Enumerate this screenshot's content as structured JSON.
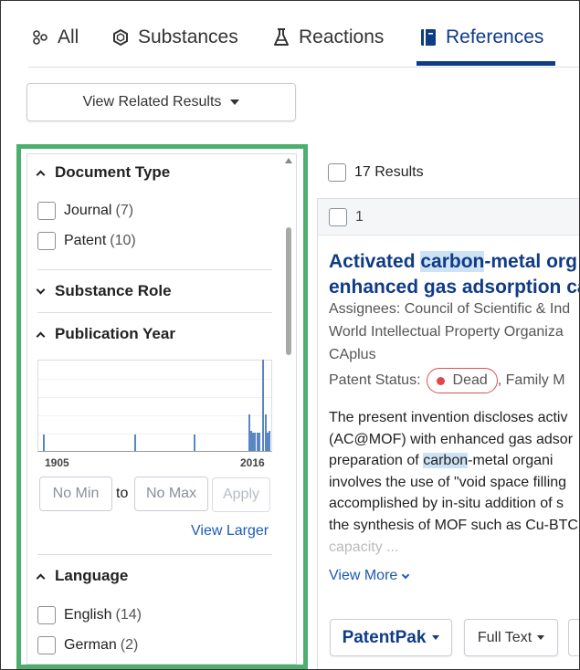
{
  "tabs": [
    {
      "label": "All",
      "icon": "all-icon"
    },
    {
      "label": "Substances",
      "icon": "substance-hexagon-icon"
    },
    {
      "label": "Reactions",
      "icon": "flask-icon"
    },
    {
      "label": "References",
      "icon": "book-icon",
      "active": true
    }
  ],
  "view_related": {
    "label": "View Related Results"
  },
  "filters": {
    "document_type": {
      "title": "Document Type",
      "options": [
        {
          "label": "Journal",
          "count": "(7)"
        },
        {
          "label": "Patent",
          "count": "(10)"
        }
      ]
    },
    "substance_role": {
      "title": "Substance Role"
    },
    "publication_year": {
      "title": "Publication Year",
      "min_label": "1905",
      "max_label": "2016",
      "min_placeholder": "No Min",
      "to_label": "to",
      "max_placeholder": "No Max",
      "apply_label": "Apply",
      "view_larger_label": "View Larger",
      "histogram": {
        "year_range": [
          1905,
          2016
        ],
        "bars": [
          {
            "year": 1905,
            "level": 0.18
          },
          {
            "year": 1950,
            "level": 0.18
          },
          {
            "year": 1979,
            "level": 0.18
          },
          {
            "year": 2006,
            "level": 0.4
          },
          {
            "year": 2007,
            "level": 0.22
          },
          {
            "year": 2008,
            "level": 0.2
          },
          {
            "year": 2009,
            "level": 0.2
          },
          {
            "year": 2010,
            "level": 0.2
          },
          {
            "year": 2011,
            "level": 0.2
          },
          {
            "year": 2013,
            "level": 1.0
          },
          {
            "year": 2014,
            "level": 0.4
          },
          {
            "year": 2015,
            "level": 0.2
          },
          {
            "year": 2016,
            "level": 0.22
          }
        ]
      }
    },
    "language": {
      "title": "Language",
      "options": [
        {
          "label": "English",
          "count": "(14)"
        },
        {
          "label": "German",
          "count": "(2)"
        }
      ]
    }
  },
  "results": {
    "count_label": "17 Results",
    "items": [
      {
        "index": "1",
        "title_line1_pre": "Activated ",
        "title_line1_hl": "carbon",
        "title_line1_post": "-metal org",
        "title_line2": "enhanced gas adsorption ca",
        "assignees_label": "Assignees:",
        "assignees_value": "Council of Scientific & Ind",
        "office": "World Intellectual Property Organiza",
        "database": "CAplus",
        "patent_status_label": "Patent Status:",
        "patent_status_value": "Dead",
        "family_label": ", Family M",
        "abstract_lines": [
          "The present invention discloses activ",
          "(AC@MOF) with enhanced gas adsor",
          "involves the use of \"void space filling",
          "accomplished by in-situ addition of s",
          "the synthesis of MOF such as Cu-BTC",
          "capacity ..."
        ],
        "abstract_line3_pre": "preparation of ",
        "abstract_line3_hl": "carbon",
        "abstract_line3_post": "-metal organi",
        "view_more_label": "View More",
        "patentpak_label": "PatentPak",
        "full_text_label": "Full Text"
      }
    ]
  },
  "colors": {
    "brand_blue": "#0f3b87",
    "link_blue": "#1a5bb5",
    "highlight": "#cde3f5",
    "focus_outline": "#4caf6e",
    "dead_status": "#e04848"
  }
}
